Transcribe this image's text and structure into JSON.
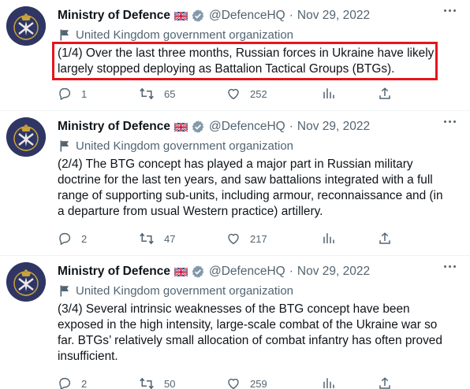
{
  "tweets": [
    {
      "name": "Ministry of Defence",
      "handle": "@DefenceHQ",
      "separator": "·",
      "date": "Nov 29, 2022",
      "org_label": "United Kingdom government organization",
      "text": "(1/4) Over the last three months, Russian forces in Ukraine have likely largely stopped deploying as Battalion Tactical Groups (BTGs).",
      "highlighted": true,
      "replies": "1",
      "retweets": "65",
      "likes": "252"
    },
    {
      "name": "Ministry of Defence",
      "handle": "@DefenceHQ",
      "separator": "·",
      "date": "Nov 29, 2022",
      "org_label": "United Kingdom government organization",
      "text": "(2/4) The BTG concept has played a major part in Russian military doctrine for the last ten years, and saw battalions integrated with a full range of supporting sub-units, including armour, reconnaissance and (in a departure from usual Western practice) artillery.",
      "highlighted": false,
      "replies": "2",
      "retweets": "47",
      "likes": "217"
    },
    {
      "name": "Ministry of Defence",
      "handle": "@DefenceHQ",
      "separator": "·",
      "date": "Nov 29, 2022",
      "org_label": "United Kingdom government organization",
      "text": "(3/4) Several intrinsic weaknesses of the BTG concept have been exposed in the high intensity, large-scale combat of the Ukraine war so far. BTGs’ relatively small allocation of combat infantry has often proved insufficient.",
      "highlighted": false,
      "replies": "2",
      "retweets": "50",
      "likes": "259"
    }
  ],
  "icons": {
    "flag": "uk-flag-icon",
    "verified": "verified-badge-icon",
    "org": "government-flag-icon",
    "reply": "reply-icon",
    "retweet": "retweet-icon",
    "like": "heart-icon",
    "views": "analytics-icon",
    "share": "share-icon",
    "more": "more-icon"
  },
  "colors": {
    "highlight": "#e8141b",
    "verified": "#829aab",
    "text": "#0f1419",
    "secondary": "#536471",
    "avatar_bg": "#2f3664"
  }
}
